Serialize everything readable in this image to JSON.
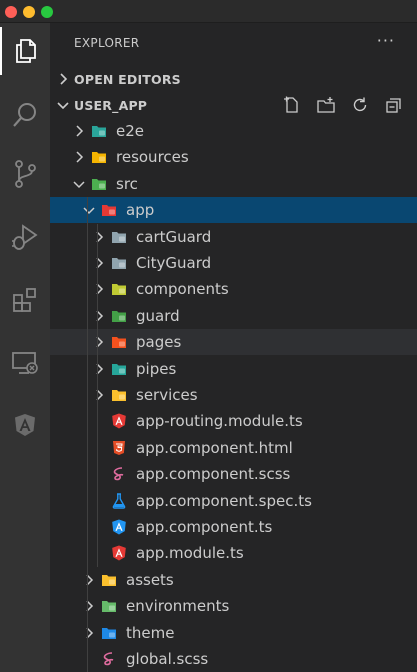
{
  "explorer": {
    "title": "EXPLORER",
    "more": "···",
    "open_editors": "OPEN EDITORS",
    "workspace": "USER_APP"
  },
  "activity_bar": [
    {
      "icon": "files-icon"
    },
    {
      "icon": "search-icon"
    },
    {
      "icon": "source-control-icon"
    },
    {
      "icon": "run-debug-icon"
    },
    {
      "icon": "extensions-icon"
    },
    {
      "icon": "remote-explorer-icon"
    },
    {
      "icon": "angular-icon"
    }
  ],
  "tree": [
    {
      "label": "e2e",
      "type": "folder",
      "color": "#2aa59a",
      "open": false
    },
    {
      "label": "resources",
      "type": "folder",
      "color": "#f5b400",
      "open": false
    },
    {
      "label": "src",
      "type": "folder",
      "color": "#4caf50",
      "open": true
    },
    {
      "label": "app",
      "type": "folder",
      "color": "#e53935",
      "open": true
    },
    {
      "label": "cartGuard",
      "type": "folder",
      "color": "#90a4ae",
      "open": false
    },
    {
      "label": "CityGuard",
      "type": "folder",
      "color": "#90a4ae",
      "open": false
    },
    {
      "label": "components",
      "type": "folder",
      "color": "#c0ca33",
      "open": false
    },
    {
      "label": "guard",
      "type": "folder",
      "color": "#43a047",
      "open": false
    },
    {
      "label": "pages",
      "type": "folder",
      "color": "#f4511e",
      "open": false
    },
    {
      "label": "pipes",
      "type": "folder",
      "color": "#26a69a",
      "open": false
    },
    {
      "label": "services",
      "type": "folder",
      "color": "#fbc02d",
      "open": false
    },
    {
      "label": "app-routing.module.ts",
      "type": "file",
      "icon": "angular-routing-icon"
    },
    {
      "label": "app.component.html",
      "type": "file",
      "icon": "html-icon"
    },
    {
      "label": "app.component.scss",
      "type": "file",
      "icon": "sass-icon"
    },
    {
      "label": "app.component.spec.ts",
      "type": "file",
      "icon": "test-flask-icon"
    },
    {
      "label": "app.component.ts",
      "type": "file",
      "icon": "angular-component-icon"
    },
    {
      "label": "app.module.ts",
      "type": "file",
      "icon": "angular-module-icon"
    },
    {
      "label": "assets",
      "type": "folder",
      "color": "#fbc02d",
      "open": false
    },
    {
      "label": "environments",
      "type": "folder",
      "color": "#66bb6a",
      "open": false
    },
    {
      "label": "theme",
      "type": "folder",
      "color": "#1e88e5",
      "open": false
    },
    {
      "label": "global.scss",
      "type": "file",
      "icon": "sass-icon"
    }
  ]
}
